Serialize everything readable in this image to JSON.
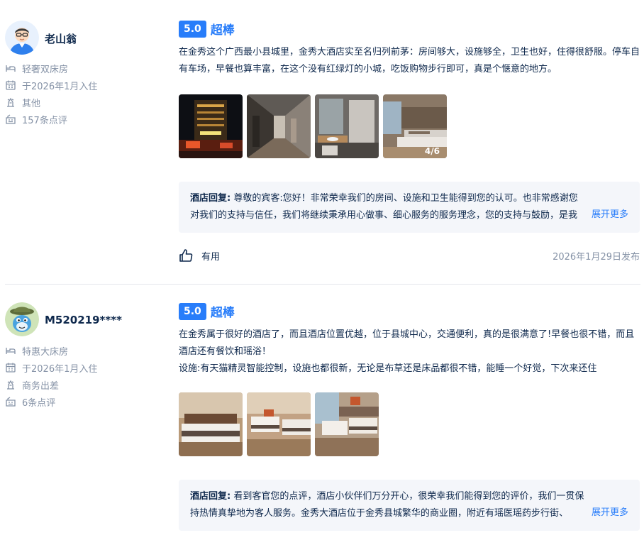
{
  "reviews": [
    {
      "user": {
        "name": "老山翁"
      },
      "meta": {
        "room": "轻奢双床房",
        "checkin": "于2026年1月入住",
        "trip_type": "其他",
        "review_count": "157条点评"
      },
      "score": "5.0",
      "score_label": "超棒",
      "text": "在金秀这个广西最小县城里，金秀大酒店实至名归列前茅：房间够大，设施够全，卫生也好，住得很舒服。停车自有车场，早餐也算丰富，在这个没有红绿灯的小城，吃饭购物步行即可，真是个惬意的地方。",
      "photos": [
        "hotel-exterior-night",
        "hotel-corridor",
        "bathroom",
        "twin-room"
      ],
      "photo_count": "4/6",
      "reply": {
        "label": "酒店回复:",
        "text": " 尊敬的宾客:您好！非常荣幸我们的房间、设施和卫生能得到您的认可。也非常感谢您对我们的支持与信任，我们将继续秉承用心做事、细心服务的服务理念，您的支持与鼓励，是我们"
      },
      "expand_label": "展开更多",
      "helpful_label": "有用",
      "date": "2026年1月29日发布"
    },
    {
      "user": {
        "name": "M520219****"
      },
      "meta": {
        "room": "特惠大床房",
        "checkin": "于2026年1月入住",
        "trip_type": "商务出差",
        "review_count": "6条点评"
      },
      "score": "5.0",
      "score_label": "超棒",
      "text_line1": "在金秀属于很好的酒店了，而且酒店位置优越，位于县城中心，交通便利，真的是很满意了!早餐也很不错，而且酒店还有餐饮和瑶浴！",
      "text_line2": "设施:有天猫精灵智能控制，设施也都很新，无论是布草还是床品都很不错，能睡一个好觉，下次来还住",
      "photos": [
        "bedroom-1",
        "bedroom-2",
        "bedroom-3"
      ],
      "reply": {
        "label": "酒店回复:",
        "text": " 看到客官您的点评，酒店小伙伴们万分开心，很荣幸我们能得到您的评价，我们一贯保持热情真挚地为客人服务。金秀大酒店位于金秀县城繁华的商业圈，附近有瑶医瑶药步行街、"
      },
      "expand_label": "展开更多"
    }
  ],
  "colors": {
    "accent": "#287dfa",
    "text": "#0f294d",
    "muted": "#8592a6",
    "reply_bg": "#f4f6fa"
  },
  "icons": [
    "bed-icon",
    "calendar-icon",
    "trip-type-icon",
    "review-count-icon",
    "thumbs-up-icon"
  ]
}
